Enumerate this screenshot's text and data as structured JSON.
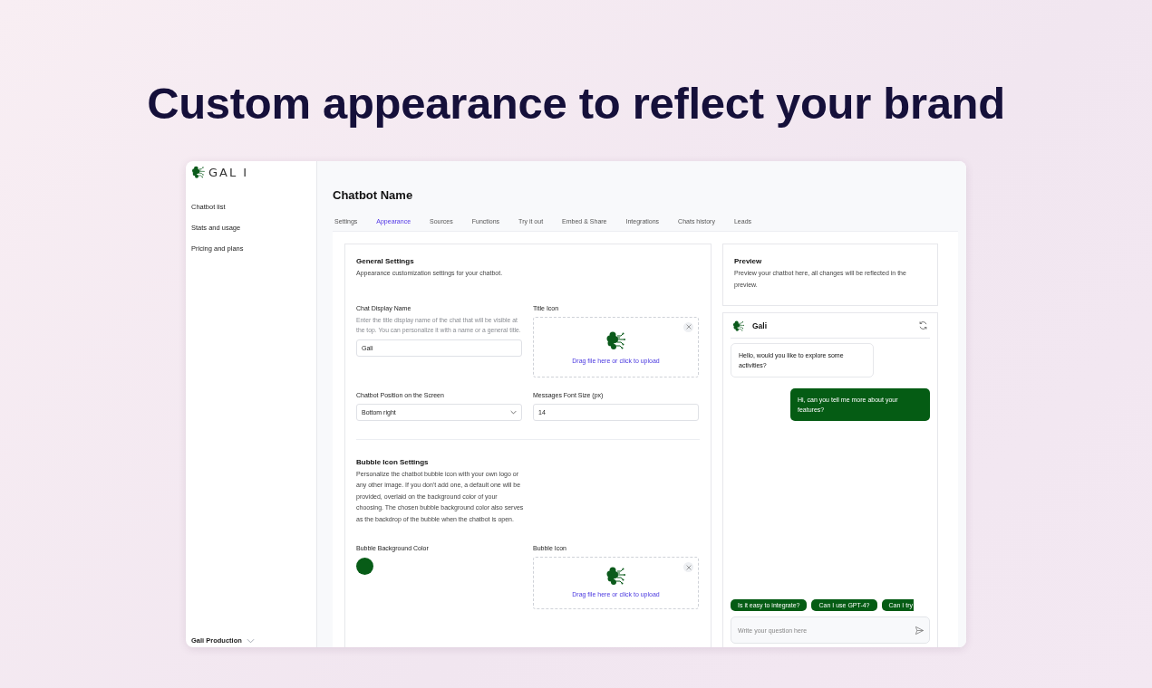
{
  "headline": "Custom appearance to reflect your brand",
  "sidebar": {
    "logo_text": "GAL I",
    "items": [
      {
        "label": "Chatbot list",
        "selected": false
      },
      {
        "label": "Stats and usage",
        "selected": false
      },
      {
        "label": "Pricing and plans",
        "selected": false
      }
    ],
    "workspace": "Gali Production"
  },
  "page_title": "Chatbot Name",
  "tabs": [
    {
      "label": "Settings",
      "selected": false
    },
    {
      "label": "Appearance",
      "selected": true
    },
    {
      "label": "Sources",
      "selected": false
    },
    {
      "label": "Functions",
      "selected": false
    },
    {
      "label": "Try it out",
      "selected": false
    },
    {
      "label": "Embed & Share",
      "selected": false
    },
    {
      "label": "Integrations",
      "selected": false
    },
    {
      "label": "Chats history",
      "selected": false
    },
    {
      "label": "Leads",
      "selected": false
    }
  ],
  "general_settings": {
    "title": "General Settings",
    "description": "Appearance customization settings for your chatbot.",
    "display_name": {
      "label": "Chat Display Name",
      "help": "Enter the title display name of the chat that will be visible at the top. You can personalize it with a name or a general title.",
      "value": "Gali"
    },
    "title_icon": {
      "label": "Title Icon",
      "upload_text": "Drag file here or click to upload"
    },
    "position": {
      "label": "Chatbot Position on the Screen",
      "value": "Bottom right"
    },
    "font_size": {
      "label": "Messages Font Size (px)",
      "value": "14"
    }
  },
  "bubble_settings": {
    "title": "Bubble Icon Settings",
    "description": "Personalize the chatbot bubble icon with your own logo or any other image. If you don't add one, a default one will be provided, overlaid on the background color of your choosing. The chosen bubble background color also serves as the backdrop of the bubble when the chatbot is open.",
    "color_label": "Bubble Background Color",
    "color": "#075c17",
    "icon_label": "Bubble Icon",
    "upload_text": "Drag file here or click to upload"
  },
  "preview": {
    "title": "Preview",
    "description": "Preview your chatbot here, all changes will be reflected in the preview.",
    "chat_name": "Gali",
    "messages": [
      {
        "kind": "bot",
        "text": "Hello, would you like to explore some activities?"
      },
      {
        "kind": "user",
        "text": "Hi, can you tell me more about your features?"
      }
    ],
    "suggestions": [
      "Is it easy to integrate?",
      "Can I use GPT-4?",
      "Can I try"
    ],
    "placeholder": "Write your question here"
  }
}
